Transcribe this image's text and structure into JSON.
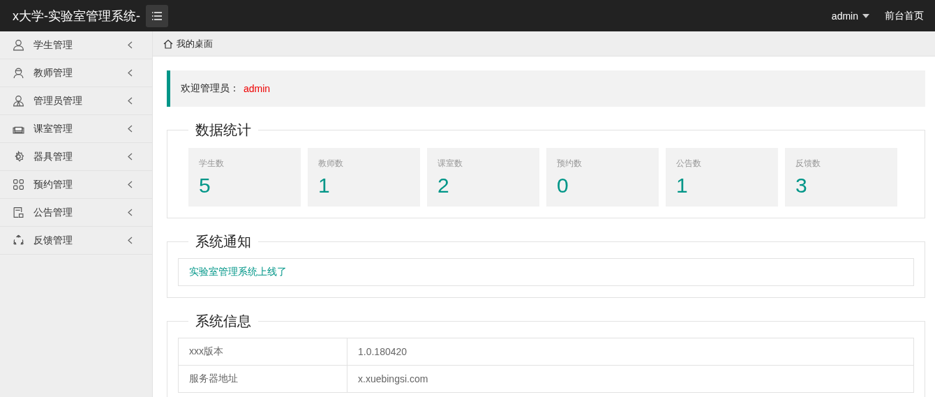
{
  "header": {
    "title": "x大学-实验室管理系统-",
    "user": "admin",
    "home_link": "前台首页"
  },
  "sidebar": {
    "items": [
      {
        "label": "学生管理"
      },
      {
        "label": "教师管理"
      },
      {
        "label": "管理员管理"
      },
      {
        "label": "课室管理"
      },
      {
        "label": "器具管理"
      },
      {
        "label": "预约管理"
      },
      {
        "label": "公告管理"
      },
      {
        "label": "反馈管理"
      }
    ]
  },
  "breadcrumb": {
    "tab": "我的桌面"
  },
  "welcome": {
    "label": "欢迎管理员：",
    "name": "admin"
  },
  "stats": {
    "title": "数据统计",
    "cards": [
      {
        "label": "学生数",
        "value": "5"
      },
      {
        "label": "教师数",
        "value": "1"
      },
      {
        "label": "课室数",
        "value": "2"
      },
      {
        "label": "预约数",
        "value": "0"
      },
      {
        "label": "公告数",
        "value": "1"
      },
      {
        "label": "反馈数",
        "value": "3"
      }
    ]
  },
  "notices": {
    "title": "系统通知",
    "items": [
      "实验室管理系统上线了"
    ]
  },
  "system_info": {
    "title": "系统信息",
    "rows": [
      [
        "xxx版本",
        "1.0.180420"
      ],
      [
        "服务器地址",
        "x.xuebingsi.com"
      ]
    ]
  }
}
